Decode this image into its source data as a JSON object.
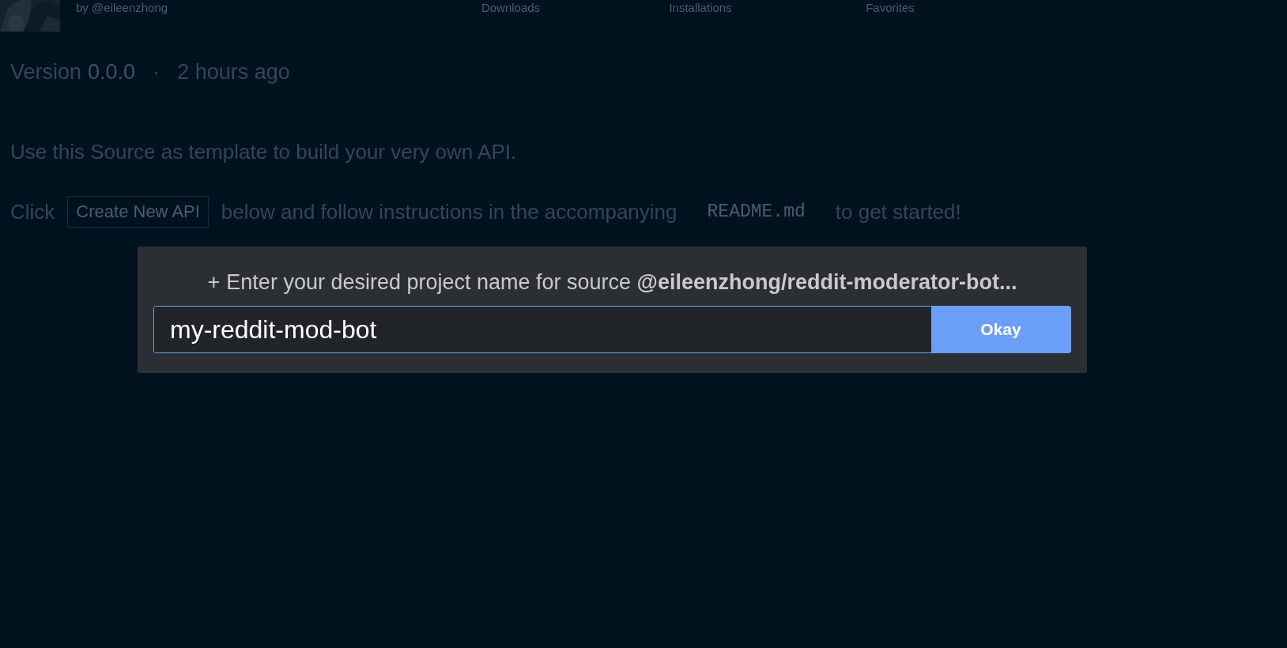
{
  "header": {
    "author": "by @eileenzhong",
    "stats": [
      "Downloads",
      "Installations",
      "Favorites"
    ]
  },
  "version": {
    "label": "Version",
    "number": "0.0.0",
    "separator": "·",
    "time": "2 hours ago"
  },
  "description": "Use this Source as template to build your very own API.",
  "instructions": {
    "before": "Click",
    "button": "Create New API",
    "middle": "below and follow instructions in the accompanying",
    "code": "README.md",
    "after": "to get started!"
  },
  "dialog": {
    "plus": "+",
    "prompt": "Enter your desired project name for source **@eileenzhong/reddit-moderator-bot...**",
    "value": "my-reddit-mod-bot",
    "button": "Okay"
  }
}
